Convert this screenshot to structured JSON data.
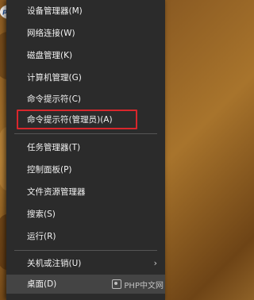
{
  "logo_badge": "php",
  "menu": {
    "items": [
      {
        "label": "设备管理器(M)"
      },
      {
        "label": "网络连接(W)"
      },
      {
        "label": "磁盘管理(K)"
      },
      {
        "label": "计算机管理(G)"
      },
      {
        "label": "命令提示符(C)"
      },
      {
        "label": "命令提示符(管理员)(A)"
      },
      {
        "label": "任务管理器(T)"
      },
      {
        "label": "控制面板(P)"
      },
      {
        "label": "文件资源管理器"
      },
      {
        "label": "搜索(S)"
      },
      {
        "label": "运行(R)"
      },
      {
        "label": "关机或注销(U)"
      },
      {
        "label": "桌面(D)"
      }
    ],
    "shutdown_chevron": "›"
  },
  "watermark": {
    "text": "PHP中文网"
  },
  "colors": {
    "menu_bg": "#2b2b2b",
    "menu_text": "#f2f2f2",
    "highlight_border": "#d8262c",
    "hover_bg": "#444444"
  }
}
